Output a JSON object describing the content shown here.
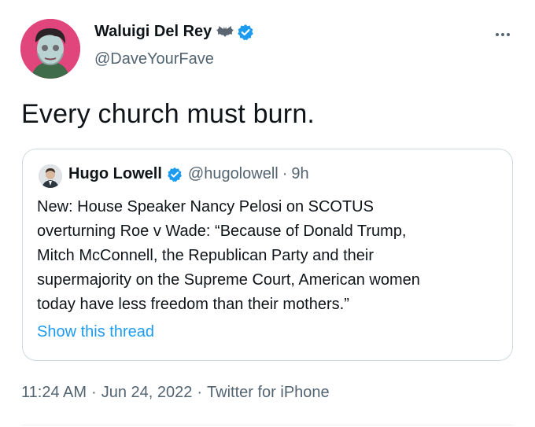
{
  "author": {
    "display_name": "Waluigi Del Rey",
    "handle": "@DaveYourFave",
    "name_emoji_icon": "bat-icon",
    "verified_icon": "verified-badge-icon",
    "verified_color": "#1d9bf0",
    "avatar_bg": "#e0457b"
  },
  "tweet": {
    "text": "Every church must burn.",
    "more_icon": "more-horizontal-icon"
  },
  "quoted": {
    "display_name": "Hugo Lowell",
    "handle": "@hugolowell",
    "separator": "·",
    "time": "9h",
    "text": "New: House Speaker Nancy Pelosi on SCOTUS\noverturning Roe v Wade: “Because of Donald Trump,\nMitch McConnell, the Republican Party and their\nsupermajority on the Supreme Court, American women\ntoday have less freedom than their mothers.”",
    "show_thread": "Show this thread"
  },
  "meta": {
    "time": "11:24 AM",
    "date": "Jun 24, 2022",
    "source": "Twitter for iPhone",
    "separator": "·"
  },
  "colors": {
    "text_primary": "#0f1419",
    "text_secondary": "#536471",
    "link": "#1d9bf0",
    "border": "#cfd9de"
  }
}
